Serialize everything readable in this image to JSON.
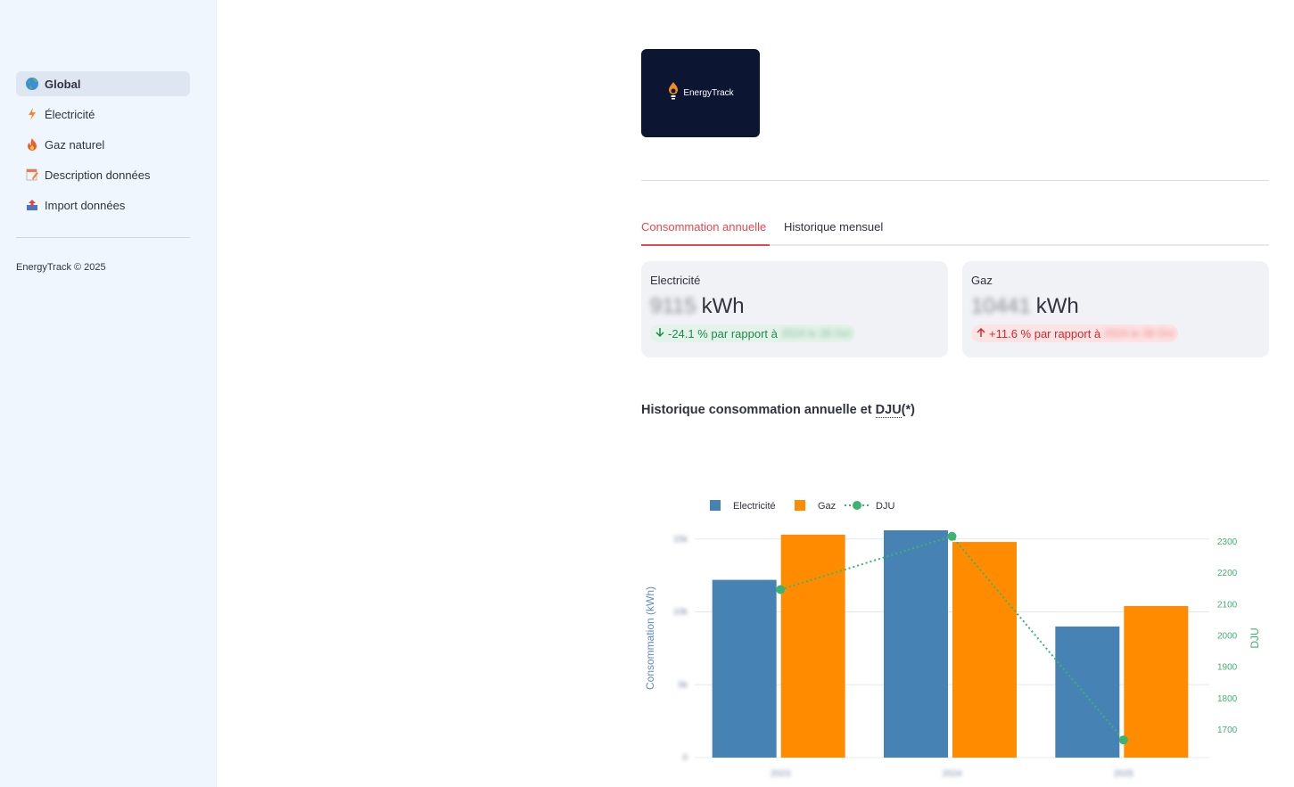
{
  "sidebar": {
    "items": [
      {
        "label": "Global",
        "icon": "globe-icon",
        "active": true
      },
      {
        "label": "Électricité",
        "icon": "lightning-icon",
        "active": false
      },
      {
        "label": "Gaz naturel",
        "icon": "flame-icon",
        "active": false
      },
      {
        "label": "Description données",
        "icon": "notepad-icon",
        "active": false
      },
      {
        "label": "Import données",
        "icon": "inbox-upload-icon",
        "active": false
      }
    ],
    "footer": "EnergyTrack © 2025"
  },
  "logo": {
    "text": "EnergyTrack"
  },
  "tabs": [
    {
      "label": "Consommation annuelle",
      "active": true
    },
    {
      "label": "Historique mensuel",
      "active": false
    }
  ],
  "metrics": [
    {
      "label": "Electricité",
      "value": "9115",
      "unit": "kWh",
      "delta": "-24.1 % par rapport à",
      "delta_ref": "2024 le 28 Oct",
      "direction": "down",
      "color": "#1e8a4a"
    },
    {
      "label": "Gaz",
      "value": "10441",
      "unit": "kWh",
      "delta": "+11.6 % par rapport à",
      "delta_ref": "2024 le 28 Oct",
      "direction": "up",
      "color": "#d2282e"
    }
  ],
  "chart_title": {
    "prefix": "Historique consommation annuelle et ",
    "abbr": "DJU",
    "suffix": "(*)"
  },
  "chart_data": {
    "type": "bar",
    "categories": [
      "2023",
      "2024",
      "2025"
    ],
    "series": [
      {
        "name": "Electricité",
        "values": [
          12200,
          15600,
          9000
        ],
        "color": "#4682b4",
        "axis": "left"
      },
      {
        "name": "Gaz",
        "values": [
          15300,
          14800,
          10400
        ],
        "color": "#ff8c00",
        "axis": "left"
      },
      {
        "name": "DJU",
        "values": [
          2145,
          2315,
          1665
        ],
        "color": "#3cb371",
        "axis": "right",
        "style": "dotted-line-markers"
      }
    ],
    "ylabel": "Consommation (kWh)",
    "y2label": "DJU",
    "ylim": [
      0,
      15600
    ],
    "yticks": [
      0,
      5000,
      10000,
      15000
    ],
    "ytick_labels": [
      "0",
      "5k",
      "10k",
      "15k"
    ],
    "y2lim": [
      1600,
      2330
    ],
    "y2ticks": [
      1700,
      1800,
      1900,
      2000,
      2100,
      2200,
      2300
    ],
    "legend": "top-left",
    "grid": true
  }
}
